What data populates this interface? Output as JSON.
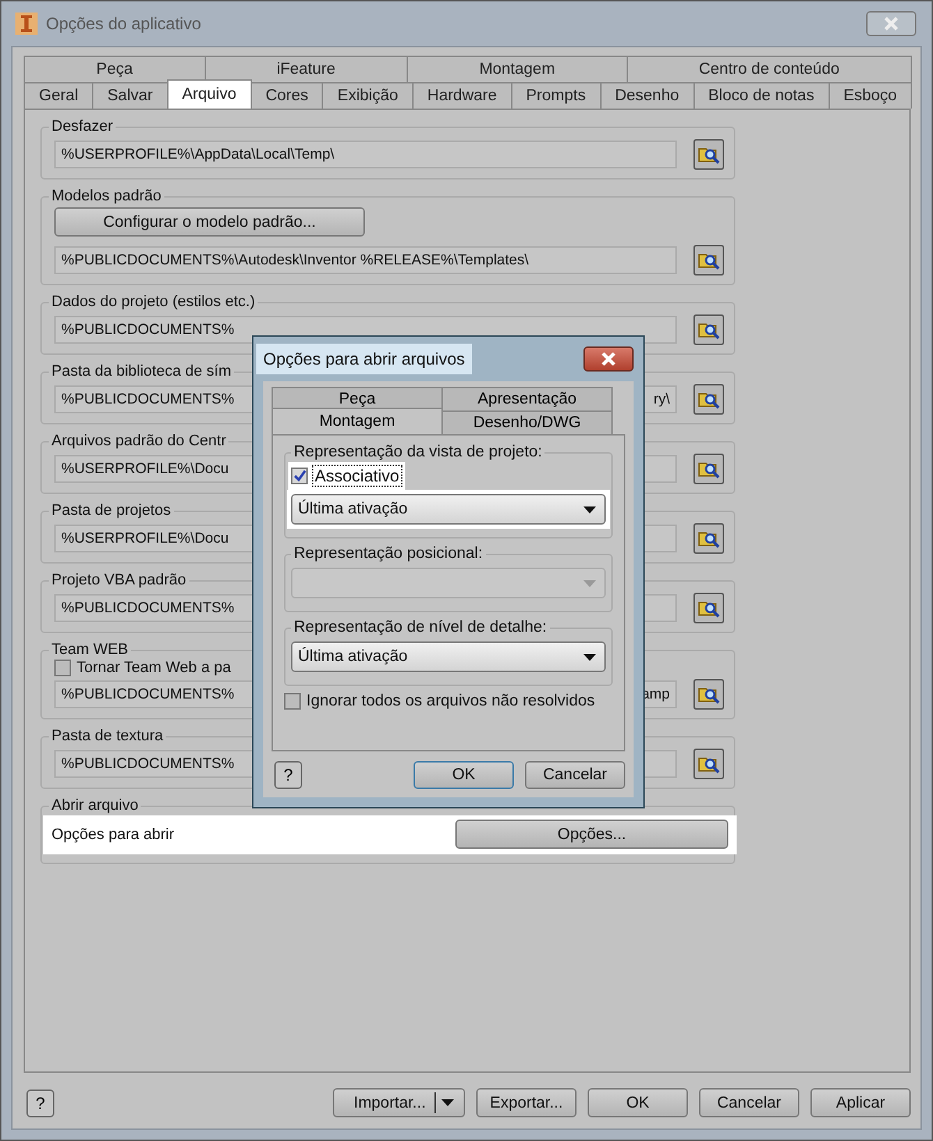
{
  "window": {
    "title": "Opções do aplicativo"
  },
  "tab_rows": [
    {
      "tabs": [
        {
          "label": "Peça",
          "selected": false
        },
        {
          "label": "iFeature",
          "selected": false
        },
        {
          "label": "Montagem",
          "selected": false
        },
        {
          "label": "Centro de conteúdo",
          "selected": false
        }
      ]
    },
    {
      "tabs": [
        {
          "label": "Geral",
          "selected": false
        },
        {
          "label": "Salvar",
          "selected": false
        },
        {
          "label": "Arquivo",
          "selected": true
        },
        {
          "label": "Cores",
          "selected": false
        },
        {
          "label": "Exibição",
          "selected": false
        },
        {
          "label": "Hardware",
          "selected": false
        },
        {
          "label": "Prompts",
          "selected": false
        },
        {
          "label": "Desenho",
          "selected": false
        },
        {
          "label": "Bloco de notas",
          "selected": false
        },
        {
          "label": "Esboço",
          "selected": false
        }
      ]
    }
  ],
  "groups": [
    {
      "title": "Desfazer",
      "items": [
        {
          "kind": "path",
          "value": "%USERPROFILE%\\AppData\\Local\\Temp\\"
        }
      ]
    },
    {
      "title": "Modelos padrão",
      "items": [
        {
          "kind": "button",
          "label": "Configurar o modelo padrão..."
        },
        {
          "kind": "path",
          "value": "%PUBLICDOCUMENTS%\\Autodesk\\Inventor %RELEASE%\\Templates\\"
        }
      ]
    },
    {
      "title": "Dados do projeto (estilos etc.)",
      "items": [
        {
          "kind": "path",
          "value": "%PUBLICDOCUMENTS%"
        }
      ]
    },
    {
      "title": "Pasta da biblioteca de sím",
      "items": [
        {
          "kind": "path",
          "value": "%PUBLICDOCUMENTS%",
          "tail": "ry\\"
        }
      ]
    },
    {
      "title": "Arquivos padrão do Centr",
      "items": [
        {
          "kind": "path",
          "value": "%USERPROFILE%\\Docu"
        }
      ]
    },
    {
      "title": "Pasta de projetos",
      "items": [
        {
          "kind": "path",
          "value": "%USERPROFILE%\\Docu"
        }
      ]
    },
    {
      "title": "Projeto VBA padrão",
      "items": [
        {
          "kind": "path",
          "value": "%PUBLICDOCUMENTS%"
        }
      ]
    },
    {
      "title": "Team WEB",
      "items": [
        {
          "kind": "checkbox",
          "label": "Tornar Team Web a pa",
          "checked": false
        },
        {
          "kind": "path",
          "value": "%PUBLICDOCUMENTS%",
          "tail": "amp"
        }
      ]
    },
    {
      "title": "Pasta de textura",
      "items": [
        {
          "kind": "path",
          "value": "%PUBLICDOCUMENTS%"
        }
      ]
    },
    {
      "title": "Abrir arquivo",
      "items": [
        {
          "kind": "action",
          "label": "Opções para abrir",
          "button": "Opções...",
          "highlighted": true
        }
      ]
    }
  ],
  "help_button": {
    "label": "?"
  },
  "buttons": [
    {
      "label": "Importar...",
      "kind": "split"
    },
    {
      "label": "Exportar...",
      "kind": "plain"
    },
    {
      "label": "OK",
      "kind": "plain"
    },
    {
      "label": "Cancelar",
      "kind": "plain"
    },
    {
      "label": "Aplicar",
      "kind": "plain"
    }
  ],
  "dialog": {
    "title": "Opções para abrir arquivos",
    "tab_rows": [
      {
        "tabs": [
          {
            "label": "Peça",
            "selected": false
          },
          {
            "label": "Apresentação",
            "selected": false
          }
        ]
      },
      {
        "tabs": [
          {
            "label": "Montagem",
            "selected": true
          },
          {
            "label": "Desenho/DWG",
            "selected": false
          }
        ]
      }
    ],
    "groups": [
      {
        "title": "Representação da vista de projeto:",
        "items": [
          {
            "kind": "checkbox",
            "label": "Associativo",
            "checked": true,
            "highlighted": true
          },
          {
            "kind": "dropdown",
            "value": "Última ativação",
            "disabled": false,
            "highlighted": true
          }
        ]
      },
      {
        "title": "Representação posicional:",
        "items": [
          {
            "kind": "dropdown",
            "disabled": true,
            "highlighted": false
          }
        ]
      },
      {
        "title": "Representação de nível de detalhe:",
        "items": [
          {
            "kind": "dropdown",
            "value": "Última ativação",
            "disabled": false,
            "highlighted": false
          }
        ]
      }
    ],
    "options": [
      {
        "kind": "checkbox",
        "label": "Ignorar todos os arquivos não resolvidos",
        "checked": false
      }
    ],
    "help_button": {
      "label": "?"
    },
    "buttons": [
      {
        "label": "OK",
        "default": true
      },
      {
        "label": "Cancelar",
        "default": false
      }
    ]
  }
}
